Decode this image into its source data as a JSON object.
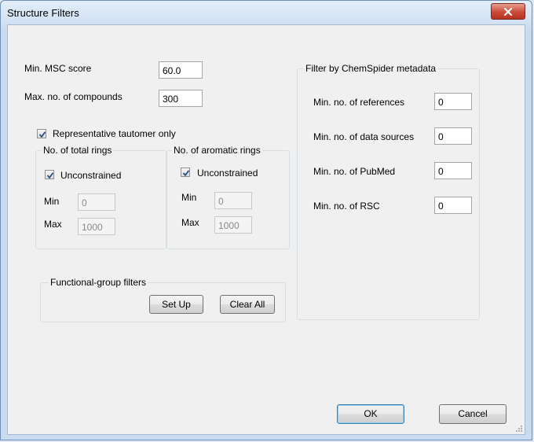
{
  "window": {
    "title": "Structure Filters"
  },
  "general": {
    "msc_label": "Min. MSC score",
    "msc_value": "60.0",
    "compounds_label": "Max. no. of compounds",
    "compounds_value": "300",
    "tautomer_label": "Representative tautomer only",
    "tautomer_checked": true
  },
  "total_rings": {
    "title": "No. of total rings",
    "unconstrained_label": "Unconstrained",
    "unconstrained_checked": true,
    "min_label": "Min",
    "min_value": "0",
    "max_label": "Max",
    "max_value": "1000"
  },
  "aromatic_rings": {
    "title": "No. of aromatic rings",
    "unconstrained_label": "Unconstrained",
    "unconstrained_checked": true,
    "min_label": "Min",
    "min_value": "0",
    "max_label": "Max",
    "max_value": "1000"
  },
  "functional_group": {
    "title": "Functional-group filters",
    "setup_label": "Set Up",
    "clear_label": "Clear All"
  },
  "chemspider": {
    "title": "Filter by ChemSpider metadata",
    "references_label": "Min. no. of references",
    "references_value": "0",
    "data_sources_label": "Min. no. of data sources",
    "data_sources_value": "0",
    "pubmed_label": "Min. no. of PubMed",
    "pubmed_value": "0",
    "rsc_label": "Min. no. of RSC",
    "rsc_value": "0"
  },
  "footer": {
    "ok_label": "OK",
    "cancel_label": "Cancel"
  },
  "icons": {
    "close": "close-icon",
    "check": "checkmark-icon",
    "grip": "resize-grip-icon"
  },
  "colors": {
    "close_button": "#c94a36",
    "window_frame": "#c9dbf0",
    "client": "#f0f0f0"
  }
}
